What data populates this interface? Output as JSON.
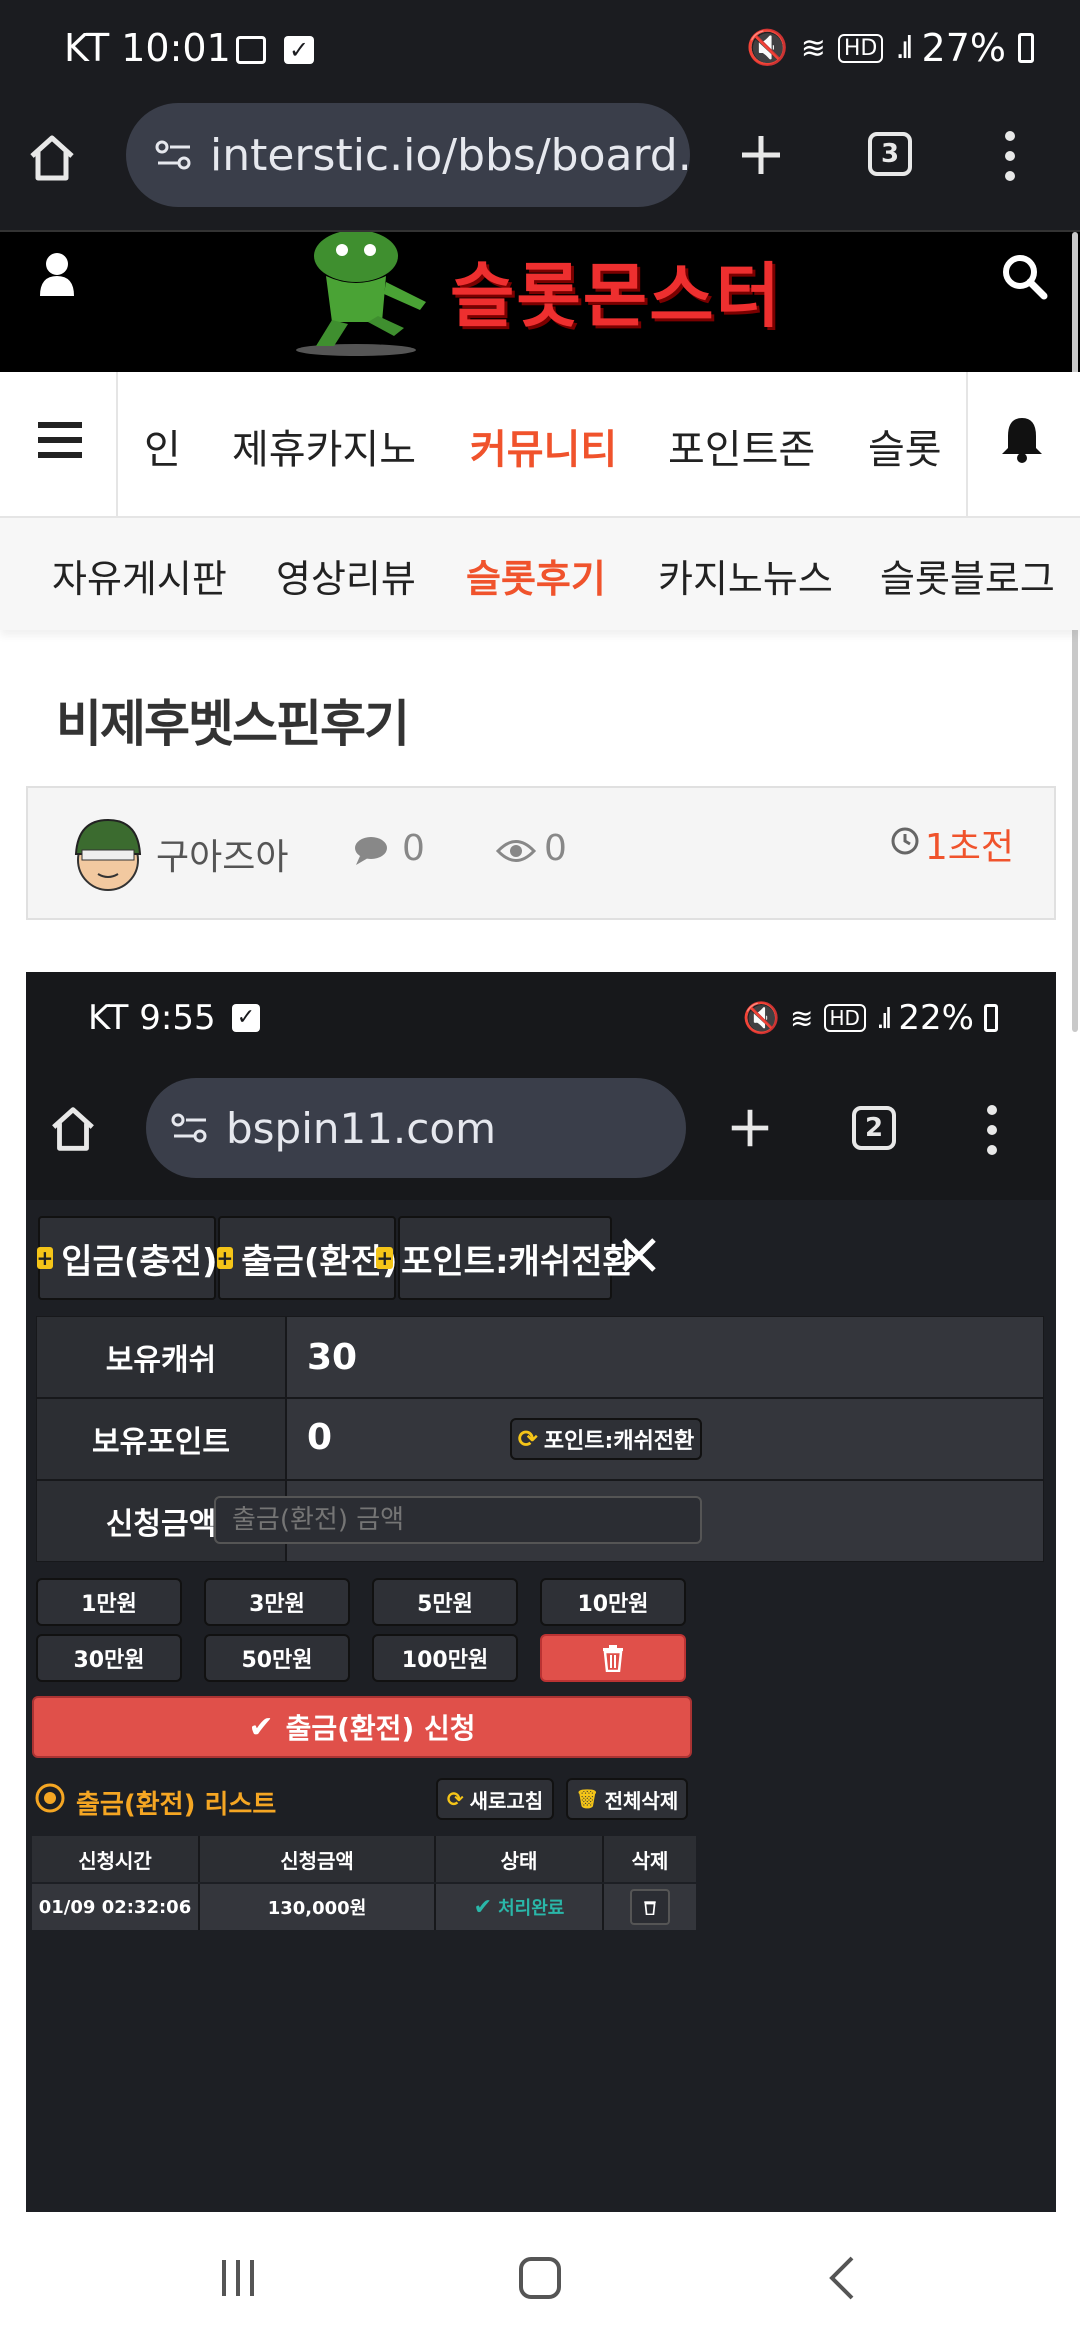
{
  "status_bar": {
    "carrier_time": "KT 10:01",
    "battery": "27%"
  },
  "browser": {
    "url": "interstic.io/bbs/board.",
    "tab_count": "3"
  },
  "site": {
    "logo_text": "슬롯몬스터"
  },
  "main_nav": {
    "items": [
      "인",
      "제휴카지노",
      "커뮤니티",
      "포인트존",
      "슬롯"
    ],
    "active_index": 2
  },
  "sub_nav": {
    "items": [
      "자유게시판",
      "영상리뷰",
      "슬롯후기",
      "카지노뉴스",
      "슬롯블로그"
    ],
    "active_index": 2
  },
  "post": {
    "title": "비제후벳스핀후기",
    "author": "구아즈아",
    "comments": "0",
    "views": "0",
    "time": "1초전"
  },
  "screenshot": {
    "status_bar": {
      "carrier_time": "KT 9:55",
      "battery": "22%"
    },
    "browser": {
      "url": "bspin11.com",
      "tab_count": "2"
    },
    "tabs": [
      "입금(충전)",
      "출금(환전)",
      "포인트:캐쉬전환"
    ],
    "rows": {
      "cash_label": "보유캐쉬",
      "cash_value": "30",
      "point_label": "보유포인트",
      "point_value": "0",
      "convert_button": "포인트:캐쉬전환",
      "request_label": "신청금액",
      "request_placeholder": "출금(환전) 금액"
    },
    "amounts": [
      "1만원",
      "3만원",
      "5만원",
      "10만원",
      "30만원",
      "50만원",
      "100만원"
    ],
    "submit_label": "출금(환전) 신청",
    "list_title": "출금(환전) 리스트",
    "refresh_label": "새로고침",
    "delete_all_label": "전체삭제",
    "table": {
      "headers": [
        "신청시간",
        "신청금액",
        "상태",
        "삭제"
      ],
      "rows": [
        {
          "time": "01/09 02:32:06",
          "amount": "130,000원",
          "status": "처리완료"
        }
      ]
    }
  },
  "colors": {
    "accent": "#f0532c",
    "danger": "#e0504a",
    "success": "#2ab7a9",
    "gold": "#f5a623"
  }
}
